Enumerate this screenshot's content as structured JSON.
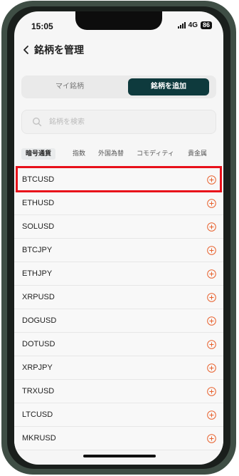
{
  "status_bar": {
    "time": "15:05",
    "network": "4G",
    "battery": "86"
  },
  "header": {
    "title": "銘柄を管理"
  },
  "segment": {
    "left_label": "マイ銘柄",
    "right_label": "銘柄を追加"
  },
  "search": {
    "placeholder": "銘柄を検索"
  },
  "categories": [
    "暗号通貨",
    "指数",
    "外国為替",
    "コモディティ",
    "貴金属"
  ],
  "symbols": [
    "BTCUSD",
    "ETHUSD",
    "SOLUSD",
    "BTCJPY",
    "ETHJPY",
    "XRPUSD",
    "DOGUSD",
    "DOTUSD",
    "XRPJPY",
    "TRXUSD",
    "LTCUSD",
    "MKRUSD"
  ],
  "colors": {
    "accent": "#e8602c",
    "segment_active": "#0e3a3d",
    "highlight": "#e8101a"
  }
}
